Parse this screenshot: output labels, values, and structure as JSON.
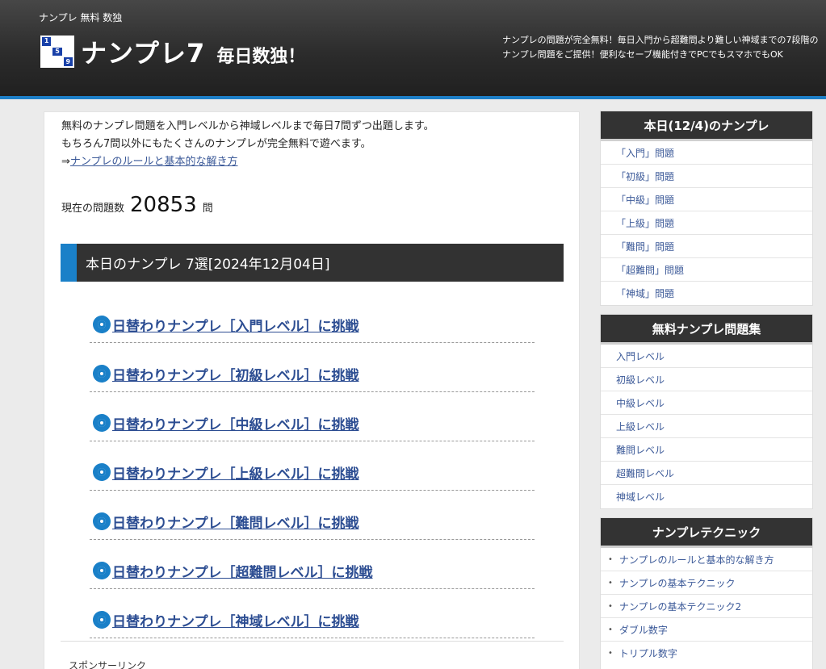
{
  "header": {
    "tagline": "ナンプレ 無料 数独",
    "logo_title": "ナンプレ7",
    "logo_subtitle": "毎日数独！",
    "logo_digits": [
      "1",
      "5",
      "9"
    ],
    "description": "ナンプレの問題が完全無料！毎日入門から超難問より難しい神域までの7段階のナンプレ問題をご提供！便利なセーブ機能付きでPCでもスマホでもOK"
  },
  "main": {
    "intro_line1": "無料のナンプレ問題を入門レベルから神域レベルまで毎日7問ずつ出題します。",
    "intro_line2": "もちろん7問以外にもたくさんのナンプレが完全無料で遊べます。",
    "rules_prefix": "⇒",
    "rules_link": "ナンプレのルールと基本的な解き方",
    "count_label": "現在の問題数",
    "count_value": "20853",
    "count_unit": "問",
    "section_title": "本日のナンプレ 7選[2024年12月04日]",
    "daily_links": [
      "日替わりナンプレ［入門レベル］に挑戦",
      "日替わりナンプレ［初級レベル］に挑戦",
      "日替わりナンプレ［中級レベル］に挑戦",
      "日替わりナンプレ［上級レベル］に挑戦",
      "日替わりナンプレ［難問レベル］に挑戦",
      "日替わりナンプレ［超難問レベル］に挑戦",
      "日替わりナンプレ［神域レベル］に挑戦"
    ],
    "sponsor_label": "スポンサーリンク"
  },
  "sidebar": {
    "today": {
      "title": "本日(12/4)のナンプレ",
      "items": [
        "「入門」問題",
        "「初級」問題",
        "「中級」問題",
        "「上級」問題",
        "「難問」問題",
        "「超難問」問題",
        "「神域」問題"
      ]
    },
    "collection": {
      "title": "無料ナンプレ問題集",
      "items": [
        "入門レベル",
        "初級レベル",
        "中級レベル",
        "上級レベル",
        "難問レベル",
        "超難問レベル",
        "神域レベル"
      ]
    },
    "technique": {
      "title": "ナンプレテクニック",
      "items": [
        "ナンプレのルールと基本的な解き方",
        "ナンプレの基本テクニック",
        "ナンプレの基本テクニック2",
        "ダブル数字",
        "トリプル数字"
      ]
    }
  },
  "colors": {
    "accent": "#1a80c8",
    "link": "#2c4d92",
    "header_bg": "#2c2c2c"
  }
}
